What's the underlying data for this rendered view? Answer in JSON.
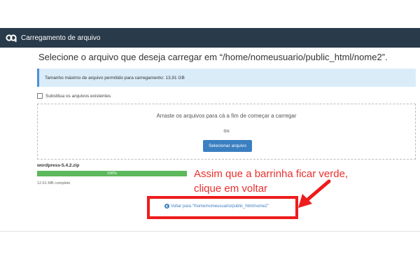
{
  "header": {
    "title": "Carregamento de arquivo",
    "logo_icon": "cpanel-logo-icon"
  },
  "page_title": "Selecione o arquivo que deseja carregar em “/home/nomeusuario/public_html/nome2”.",
  "info": {
    "text": "Tamanho máximo de arquivo permitido para carregamento: 13,91 GB"
  },
  "overwrite": {
    "label": "Substitua os arquivos existentes",
    "checked": false
  },
  "dropzone": {
    "text": "Arraste os arquivos para cá a fim de começar a carregar",
    "or": "ou",
    "button": "Selecionar arquivo"
  },
  "upload": {
    "file_name": "wordpress-5.4.2.zip",
    "progress_label": "100%",
    "progress_percent": 100,
    "status": "12.61 MB complete"
  },
  "annotation": {
    "line1": "Assim que a barrinha ficar verde,",
    "line2": "clique em voltar"
  },
  "back_link": {
    "text": "Voltar para “/home/nomeusuario/public_html/nome2”",
    "icon": "arrow-circle-left-icon"
  },
  "colors": {
    "header_bg": "#293a4a",
    "accent_blue": "#3a7fc1",
    "progress_green": "#5cb85c",
    "annotation_red": "#e8302d",
    "highlight_red": "#ee1c1c",
    "info_bg": "#dbecf9"
  }
}
